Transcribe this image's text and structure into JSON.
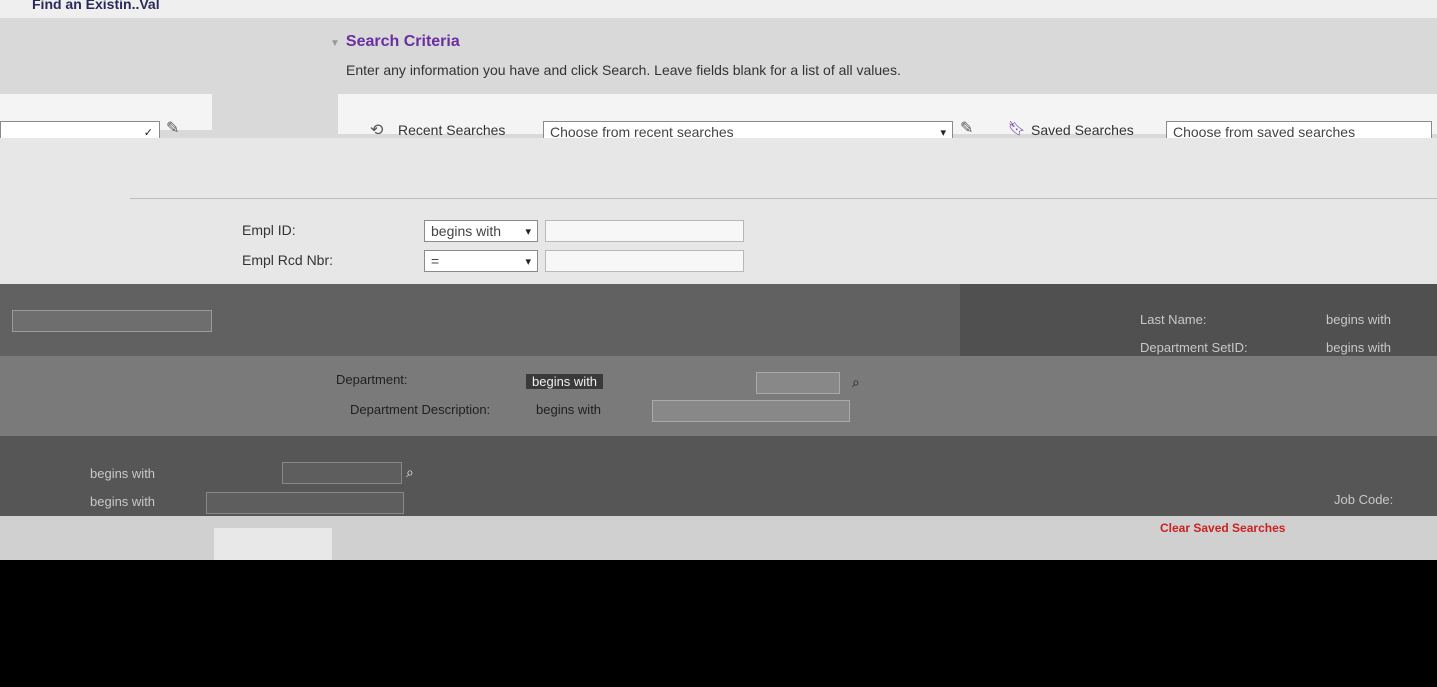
{
  "page": {
    "title": "Find an Existin..Val"
  },
  "search_criteria": {
    "heading": "Search Criteria",
    "instructions": "Enter any information you have and click Search. Leave fields blank for a list of all values."
  },
  "recent_searches": {
    "label": "Recent Searches",
    "placeholder": "Choose from recent searches"
  },
  "saved_searches": {
    "label": "Saved Searches",
    "placeholder": "Choose from saved searches"
  },
  "fields": [
    {
      "label": "Empl ID:",
      "operator": "begins with"
    },
    {
      "label": "Empl Rcd Nbr:",
      "operator": "="
    }
  ],
  "right_column": {
    "last_name_label": "Last Name:",
    "dept_setid_label": "Department SetID:",
    "begins_with": "begins with"
  },
  "lower_fields": {
    "department_label": "Department:",
    "department_operator": "begins with",
    "department_description_label": "Department Description:",
    "department_description_operator": "begins with",
    "left_operator_1": "begins with",
    "left_operator_2": "begins with",
    "job_code_label": "Job Code:"
  },
  "clear_link": "Clear Saved Searches",
  "colors": {
    "accent": "#6a2fa0",
    "link_red": "#cc2222"
  }
}
